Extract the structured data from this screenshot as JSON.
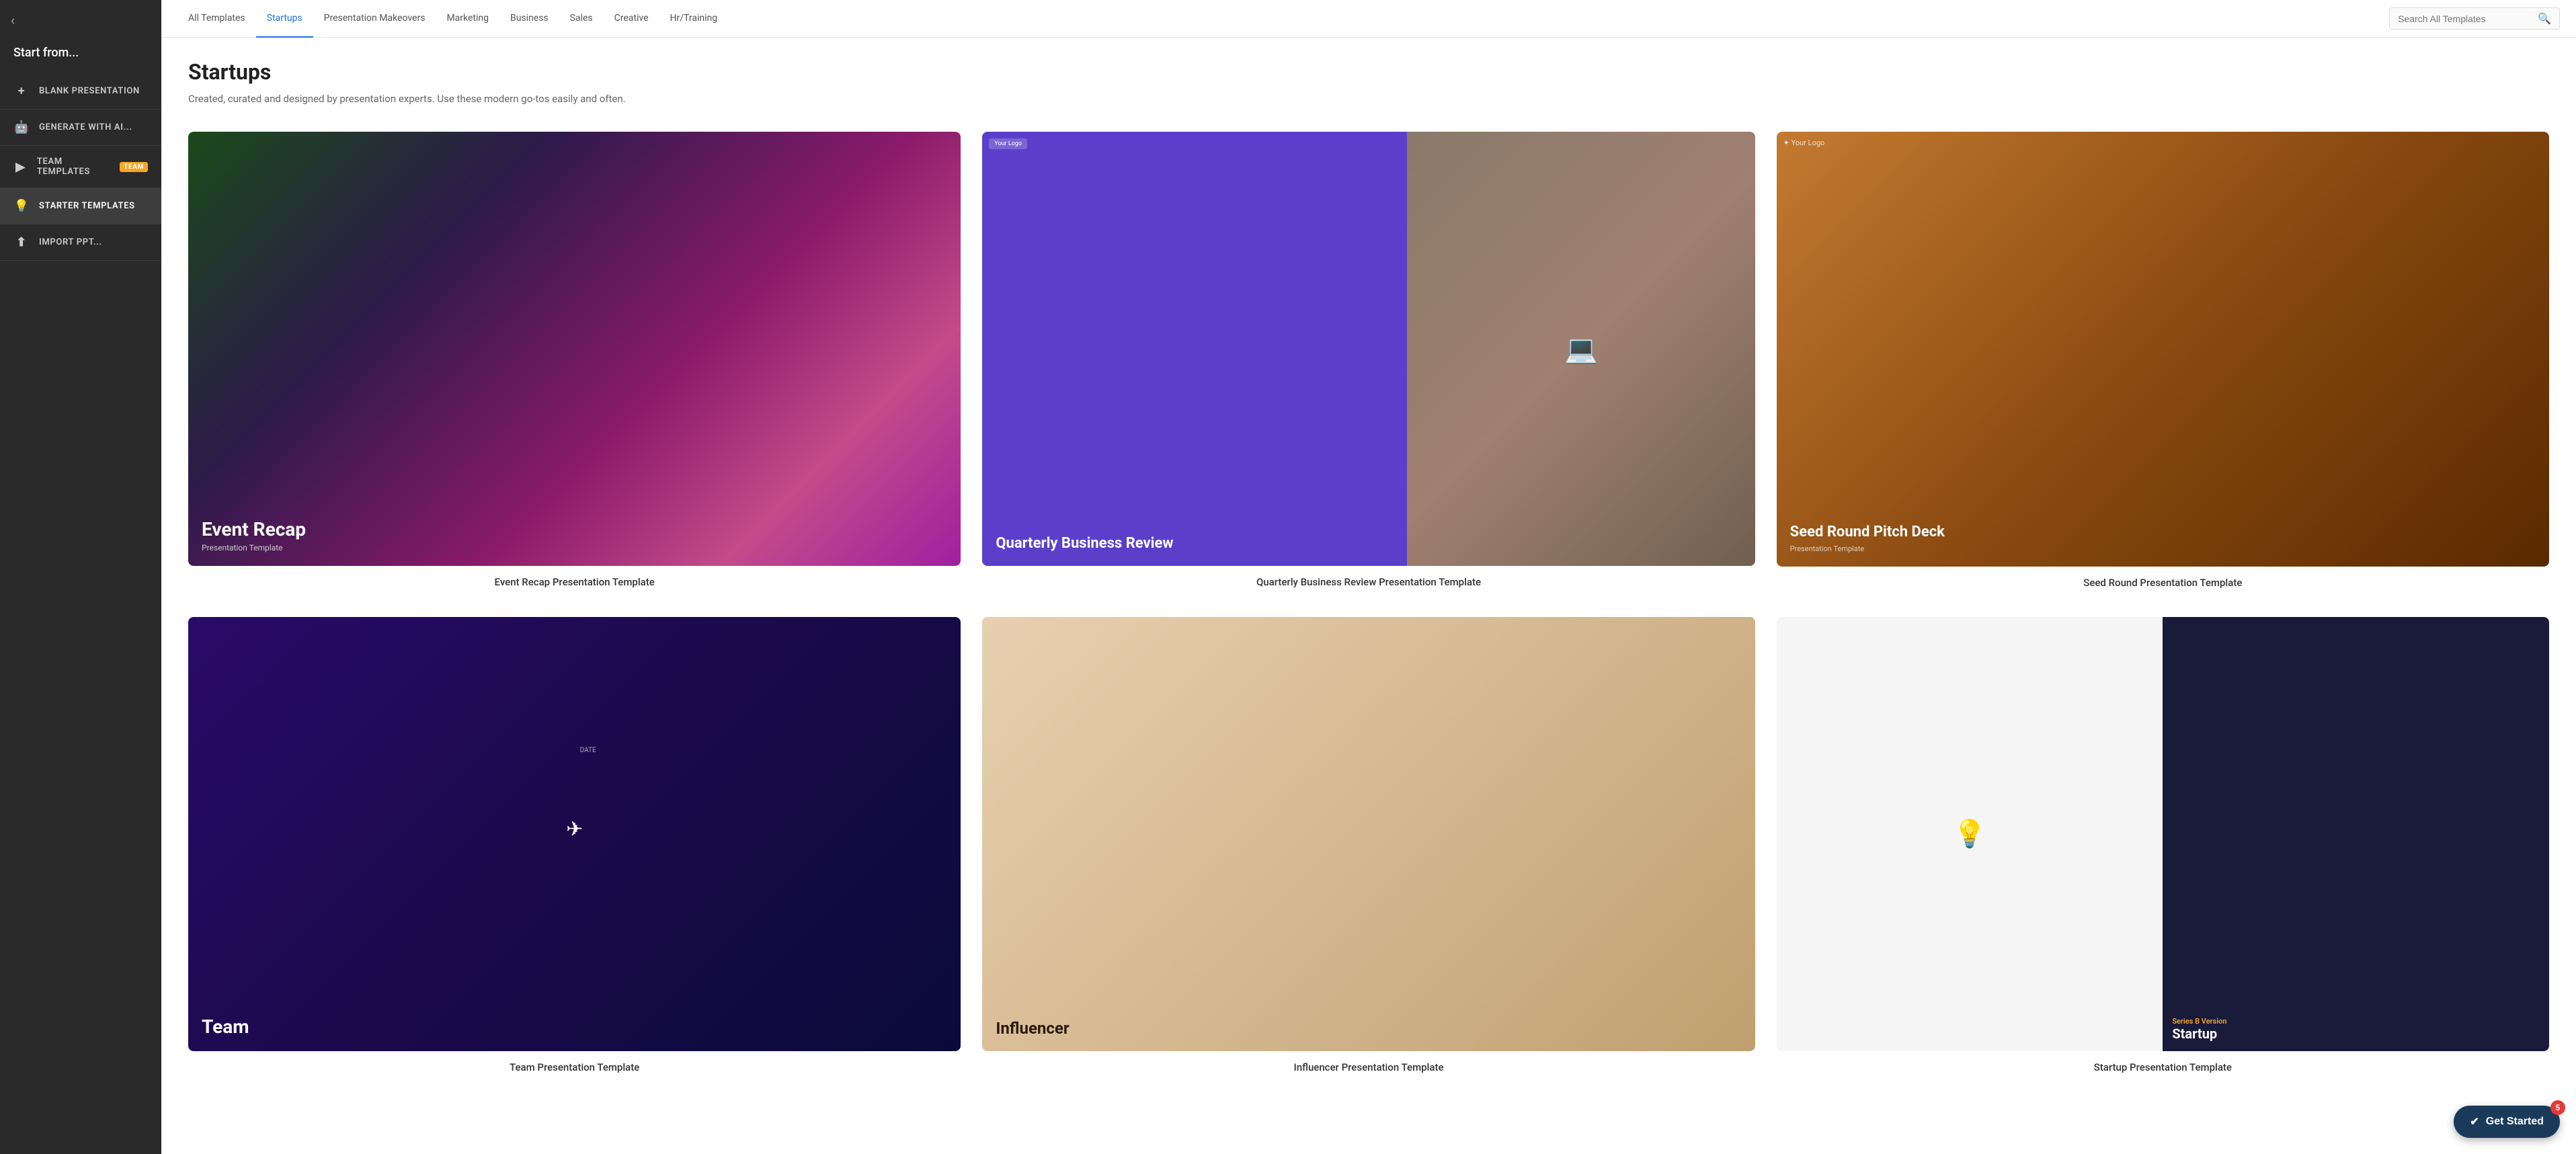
{
  "sidebar": {
    "collapse_icon": "‹",
    "title": "Start from...",
    "items": [
      {
        "id": "blank",
        "label": "BLANK PRESENTATION",
        "icon": "+"
      },
      {
        "id": "ai",
        "label": "GENERATE WITH AI...",
        "icon": "🤖"
      },
      {
        "id": "team",
        "label": "TEAM TEMPLATES",
        "icon": "▶",
        "badge": "TEAM"
      },
      {
        "id": "starter",
        "label": "STARTER TEMPLATES",
        "icon": "💡",
        "active": true
      },
      {
        "id": "import",
        "label": "IMPORT PPT...",
        "icon": "⬆"
      }
    ]
  },
  "nav": {
    "tabs": [
      {
        "id": "all",
        "label": "All Templates",
        "active": false
      },
      {
        "id": "startups",
        "label": "Startups",
        "active": true
      },
      {
        "id": "makeovers",
        "label": "Presentation Makeovers",
        "active": false
      },
      {
        "id": "marketing",
        "label": "Marketing",
        "active": false
      },
      {
        "id": "business",
        "label": "Business",
        "active": false
      },
      {
        "id": "sales",
        "label": "Sales",
        "active": false
      },
      {
        "id": "creative",
        "label": "Creative",
        "active": false
      },
      {
        "id": "hr",
        "label": "Hr/Training",
        "active": false
      }
    ],
    "search_placeholder": "Search All Templates"
  },
  "content": {
    "heading": "Startups",
    "subtitle": "Created, curated and designed by presentation experts. Use these modern go-tos easily and often.",
    "templates_row1": [
      {
        "id": "event-recap",
        "name": "Event Recap Presentation Template",
        "thumb_type": "event-recap",
        "thumb_title": "Event Recap",
        "thumb_sub": "Presentation Template"
      },
      {
        "id": "qbr",
        "name": "Quarterly Business Review Presentation Template",
        "thumb_type": "qbr",
        "thumb_title": "Quarterly Business Review",
        "thumb_logo": "Your Logo"
      },
      {
        "id": "seed-round",
        "name": "Seed Round Presentation Template",
        "thumb_type": "seed",
        "thumb_title": "Seed Round Pitch Deck",
        "thumb_sub": "Presentation Template",
        "thumb_logo": "Your Logo"
      }
    ],
    "templates_row2": [
      {
        "id": "team",
        "name": "Team Presentation Template",
        "thumb_type": "team",
        "thumb_label": "DATE",
        "thumb_bottom": "Team"
      },
      {
        "id": "influencer",
        "name": "Influencer Presentation Template",
        "thumb_type": "influencer",
        "thumb_title": "Influencer"
      },
      {
        "id": "startup",
        "name": "Startup Presentation Template",
        "thumb_type": "startup",
        "thumb_series": "Series B Version",
        "thumb_title": "Startup"
      }
    ]
  },
  "get_started": {
    "label": "Get Started",
    "badge": "5"
  },
  "url_bar": "https://www.beautiful.ai/all-presentation-templates#w-tabs-0-data-w-pane-1"
}
